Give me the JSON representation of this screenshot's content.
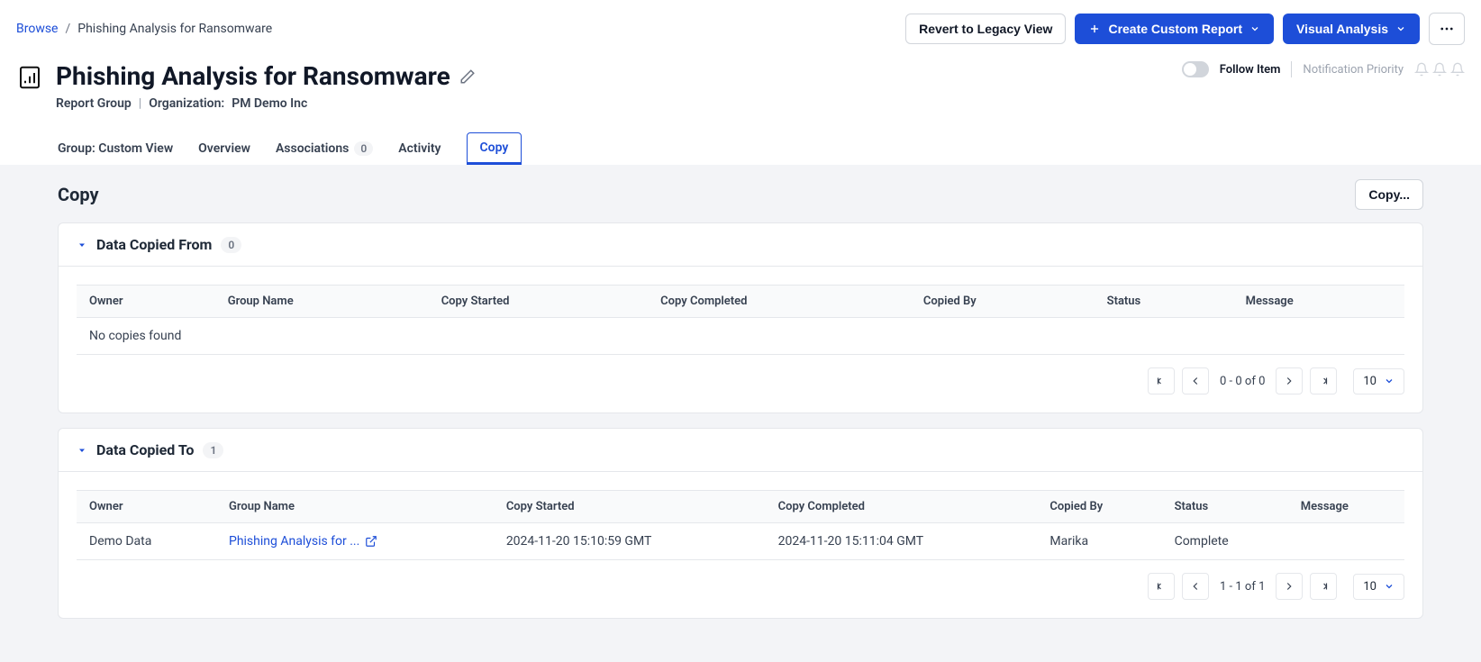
{
  "breadcrumb": {
    "browse": "Browse",
    "current": "Phishing Analysis for Ransomware"
  },
  "actions": {
    "revert": "Revert to Legacy View",
    "create_report": "Create Custom Report",
    "visual_analysis": "Visual Analysis"
  },
  "title": "Phishing Analysis for Ransomware",
  "subtitle": {
    "report_group": "Report Group",
    "org_label": "Organization:",
    "org_name": "PM Demo Inc"
  },
  "follow": {
    "label": "Follow Item",
    "notif": "Notification Priority"
  },
  "tabs": {
    "group": "Group: Custom View",
    "overview": "Overview",
    "associations": "Associations",
    "associations_count": "0",
    "activity": "Activity",
    "copy": "Copy"
  },
  "content": {
    "heading": "Copy",
    "copy_btn": "Copy...",
    "columns": {
      "owner": "Owner",
      "group": "Group Name",
      "started": "Copy Started",
      "completed": "Copy Completed",
      "by": "Copied By",
      "status": "Status",
      "message": "Message"
    },
    "from": {
      "title": "Data Copied From",
      "count": "0",
      "empty": "No copies found",
      "range": "0 - 0 of 0",
      "page_size": "10"
    },
    "to": {
      "title": "Data Copied To",
      "count": "1",
      "row": {
        "owner": "Demo Data",
        "group": "Phishing Analysis for ...",
        "started": "2024-11-20 15:10:59 GMT",
        "completed": "2024-11-20 15:11:04 GMT",
        "by": "Marika",
        "status": "Complete",
        "message": ""
      },
      "range": "1 - 1 of 1",
      "page_size": "10"
    }
  }
}
